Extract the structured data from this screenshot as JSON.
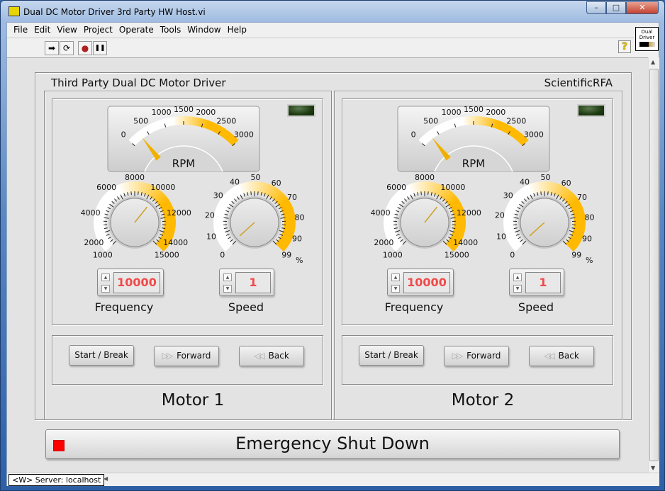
{
  "window": {
    "title": "Dual DC Motor Driver 3rd Party HW Host.vi",
    "min": "–",
    "max": "□",
    "close": "✕"
  },
  "menu": [
    "File",
    "Edit",
    "View",
    "Project",
    "Operate",
    "Tools",
    "Window",
    "Help"
  ],
  "toolbar": {
    "run": "➡",
    "run_continuous": "⟳",
    "abort": "●",
    "pause": "❚❚",
    "help": "?"
  },
  "vi_icon": {
    "label": "Dual Driver"
  },
  "panel": {
    "title": "Third Party Dual DC Motor Driver",
    "brand": "ScientificRFA"
  },
  "scale_colors": {
    "low": "#ffffff",
    "high": "#ffb900"
  },
  "motors": [
    {
      "name": "Motor 1",
      "rpm": {
        "label": "RPM",
        "value": 300,
        "min": 0,
        "max": 3000,
        "ticks": [
          "0",
          "500",
          "1000",
          "1500",
          "2000",
          "2500",
          "3000"
        ]
      },
      "frequency": {
        "label": "Frequency",
        "value": "10000",
        "ticks": [
          "1000",
          "2000",
          "4000",
          "6000",
          "8000",
          "10000",
          "12000",
          "14000",
          "15000"
        ]
      },
      "speed": {
        "label": "Speed",
        "value": "1",
        "unit": "%",
        "ticks": [
          "0",
          "10",
          "20",
          "30",
          "40",
          "50",
          "60",
          "70",
          "80",
          "90",
          "99"
        ]
      },
      "buttons": {
        "start": "Start / Break",
        "forward": "Forward",
        "back": "Back"
      },
      "led_on": false
    },
    {
      "name": "Motor 2",
      "rpm": {
        "label": "RPM",
        "value": 300,
        "min": 0,
        "max": 3000,
        "ticks": [
          "0",
          "500",
          "1000",
          "1500",
          "2000",
          "2500",
          "3000"
        ]
      },
      "frequency": {
        "label": "Frequency",
        "value": "10000",
        "ticks": [
          "1000",
          "2000",
          "4000",
          "6000",
          "8000",
          "10000",
          "12000",
          "14000",
          "15000"
        ]
      },
      "speed": {
        "label": "Speed",
        "value": "1",
        "unit": "%",
        "ticks": [
          "0",
          "10",
          "20",
          "30",
          "40",
          "50",
          "60",
          "70",
          "80",
          "90",
          "99"
        ]
      },
      "buttons": {
        "start": "Start / Break",
        "forward": "Forward",
        "back": "Back"
      },
      "led_on": false
    }
  ],
  "emergency": {
    "label": "Emergency Shut Down"
  },
  "status": {
    "server": "<W> Server: localhost"
  }
}
